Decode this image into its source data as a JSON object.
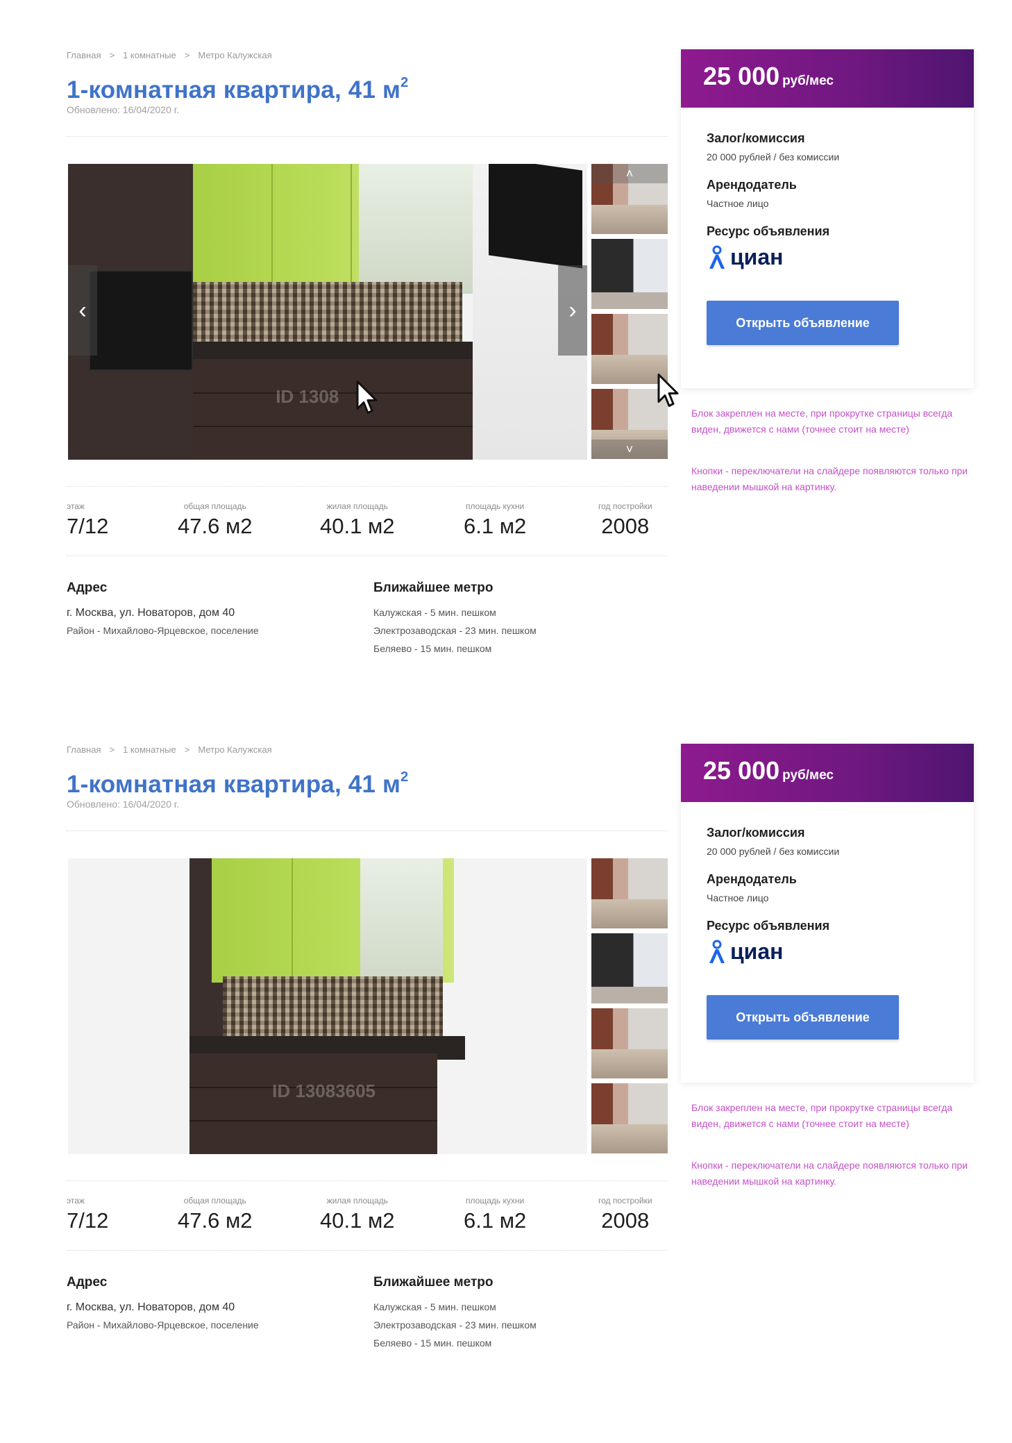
{
  "sections": [
    {
      "breadcrumb": [
        "Главная",
        "1 комнатные",
        "Метро Калужская"
      ],
      "breadcrumb_sep": ">",
      "title": "1-комнатная квартира, 41 м",
      "title_sup": "2",
      "updated": "Обновлено: 16/04/2020 г.",
      "photo_watermark": "ID 1308",
      "stats": [
        {
          "label": "этаж",
          "value": "7/12"
        },
        {
          "label": "общая площадь",
          "value": "47.6 м2"
        },
        {
          "label": "жилая площадь",
          "value": "40.1 м2"
        },
        {
          "label": "площадь кухни",
          "value": "6.1 м2"
        },
        {
          "label": "год постройки",
          "value": "2008"
        }
      ],
      "address": {
        "heading": "Адрес",
        "line": "г. Москва, ул. Новаторов, дом 40",
        "district": "Район - Михайлово-Ярцевское, поселение"
      },
      "metro": {
        "heading": "Ближайшее метро",
        "stations": [
          "Калужская - 5 мин. пешком",
          "Электрозаводская - 23 мин. пешком",
          "Беляево - 15 мин. пешком"
        ]
      },
      "card": {
        "price": "25 000",
        "price_unit": "руб/мес",
        "deposit_label": "Залог/комиссия",
        "deposit_value": "20 000 рублей / без комиссии",
        "landlord_label": "Арендодатель",
        "landlord_value": "Частное лицо",
        "source_label": "Ресурс объявления",
        "logo_text": "циан",
        "button": "Открыть объявление"
      },
      "notes": [
        "Блок закреплен на месте, при прокрутке страницы всегда виден, движется с нами (точнее стоит на месте)",
        "Кнопки - переключатели на слайдере появляются только при наведении мышкой на картинку."
      ],
      "nav_prev": "‹",
      "nav_next": "›",
      "thumb_up": "˄",
      "thumb_down": "˅"
    },
    {
      "breadcrumb": [
        "Главная",
        "1 комнатные",
        "Метро Калужская"
      ],
      "breadcrumb_sep": ">",
      "title": "1-комнатная квартира, 41 м",
      "title_sup": "2",
      "updated": "Обновлено: 16/04/2020 г.",
      "photo_watermark": "ID 13083605",
      "stats": [
        {
          "label": "этаж",
          "value": "7/12"
        },
        {
          "label": "общая площадь",
          "value": "47.6 м2"
        },
        {
          "label": "жилая площадь",
          "value": "40.1 м2"
        },
        {
          "label": "площадь кухни",
          "value": "6.1 м2"
        },
        {
          "label": "год постройки",
          "value": "2008"
        }
      ],
      "address": {
        "heading": "Адрес",
        "line": "г. Москва, ул. Новаторов, дом 40",
        "district": "Район - Михайлово-Ярцевское, поселение"
      },
      "metro": {
        "heading": "Ближайшее метро",
        "stations": [
          "Калужская - 5 мин. пешком",
          "Электрозаводская - 23 мин. пешком",
          "Беляево - 15 мин. пешком"
        ]
      },
      "card": {
        "price": "25 000",
        "price_unit": "руб/мес",
        "deposit_label": "Залог/комиссия",
        "deposit_value": "20 000 рублей / без комиссии",
        "landlord_label": "Арендодатель",
        "landlord_value": "Частное лицо",
        "source_label": "Ресурс объявления",
        "logo_text": "циан",
        "button": "Открыть объявление"
      },
      "notes": [
        "Блок закреплен на месте, при прокрутке страницы всегда виден, движется с нами (точнее стоит на месте)",
        "Кнопки - переключатели на слайдере появляются только при наведении мышкой на картинку."
      ]
    }
  ],
  "colors": {
    "title": "#3f73c8",
    "button": "#4a7bd6",
    "price_gradient_start": "#8e1a8f",
    "price_gradient_end": "#4f1570",
    "note": "#c351c7",
    "logo": "#0a1f5b"
  }
}
